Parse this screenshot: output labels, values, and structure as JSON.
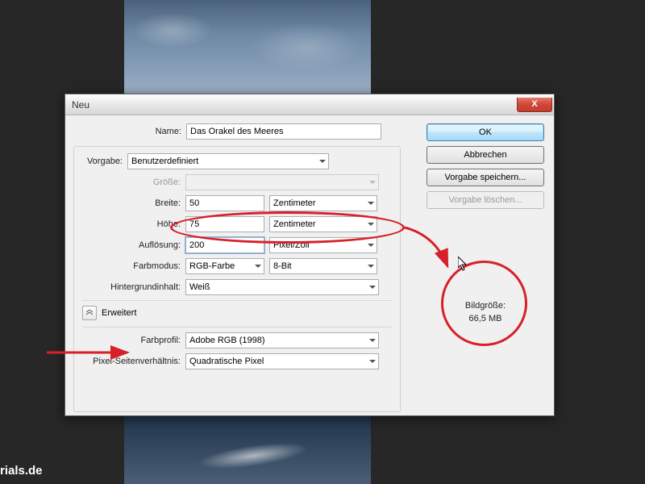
{
  "watermark": "rials.de",
  "dialog": {
    "title": "Neu",
    "close_label": "X",
    "name_label": "Name:",
    "name_value": "Das Orakel des Meeres",
    "preset_label": "Vorgabe:",
    "preset_value": "Benutzerdefiniert",
    "size_label": "Größe:",
    "size_value": "",
    "width_label": "Breite:",
    "width_value": "50",
    "width_unit": "Zentimeter",
    "height_label": "Höhe:",
    "height_value": "75",
    "height_unit": "Zentimeter",
    "res_label": "Auflösung:",
    "res_value": "200",
    "res_unit": "Pixel/Zoll",
    "mode_label": "Farbmodus:",
    "mode_value": "RGB-Farbe",
    "depth_value": "8-Bit",
    "bg_label": "Hintergrundinhalt:",
    "bg_value": "Weiß",
    "advanced_label": "Erweitert",
    "profile_label": "Farbprofil:",
    "profile_value": "Adobe RGB (1998)",
    "par_label": "Pixel-Seitenverhältnis:",
    "par_value": "Quadratische Pixel",
    "imgsize_label": "Bildgröße:",
    "imgsize_value": "66,5 MB",
    "buttons": {
      "ok": "OK",
      "cancel": "Abbrechen",
      "save_preset": "Vorgabe speichern...",
      "delete_preset": "Vorgabe löschen..."
    }
  }
}
